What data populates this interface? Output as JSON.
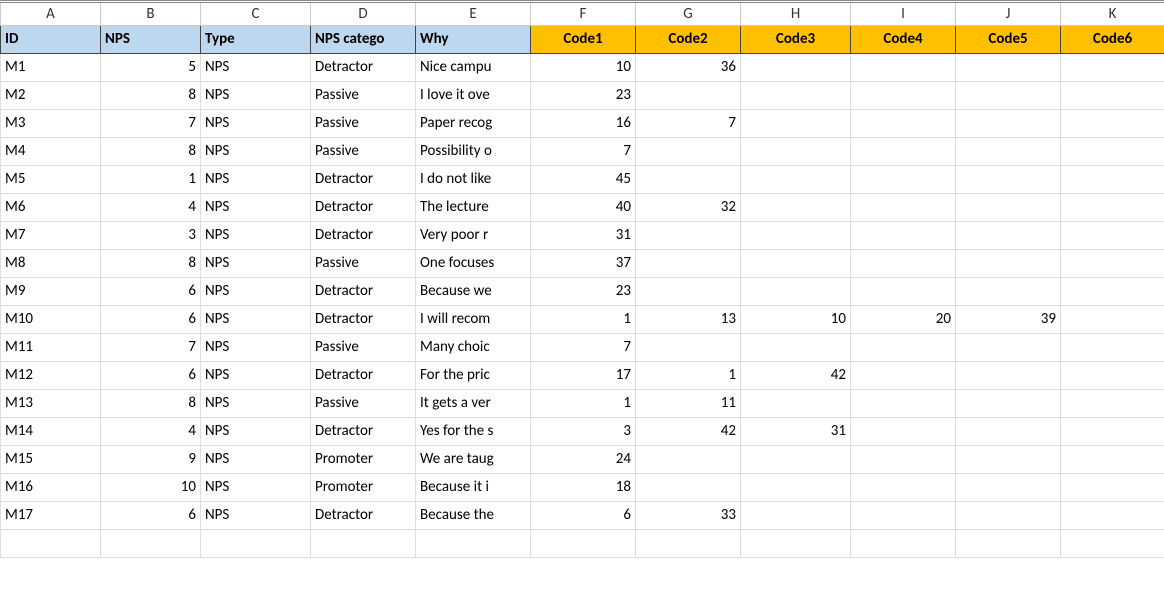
{
  "columns": [
    "A",
    "B",
    "C",
    "D",
    "E",
    "F",
    "G",
    "H",
    "I",
    "J",
    "K"
  ],
  "headers": {
    "blue": [
      "ID",
      "NPS",
      "Type",
      "NPS catego",
      "Why"
    ],
    "gold": [
      "Code1",
      "Code2",
      "Code3",
      "Code4",
      "Code5",
      "Code6"
    ]
  },
  "rows": [
    {
      "id": "M1",
      "nps": 5,
      "type": "NPS",
      "cat": "Detractor",
      "why": "Nice campu",
      "c": [
        10,
        36,
        "",
        "",
        "",
        ""
      ]
    },
    {
      "id": "M2",
      "nps": 8,
      "type": "NPS",
      "cat": "Passive",
      "why": "I love it ove",
      "c": [
        23,
        "",
        "",
        "",
        "",
        ""
      ]
    },
    {
      "id": "M3",
      "nps": 7,
      "type": "NPS",
      "cat": "Passive",
      "why": "Paper recog",
      "c": [
        16,
        7,
        "",
        "",
        "",
        ""
      ]
    },
    {
      "id": "M4",
      "nps": 8,
      "type": "NPS",
      "cat": "Passive",
      "why": "Possibility o",
      "c": [
        7,
        "",
        "",
        "",
        "",
        ""
      ]
    },
    {
      "id": "M5",
      "nps": 1,
      "type": "NPS",
      "cat": "Detractor",
      "why": "I do not like",
      "c": [
        45,
        "",
        "",
        "",
        "",
        ""
      ]
    },
    {
      "id": "M6",
      "nps": 4,
      "type": "NPS",
      "cat": "Detractor",
      "why": "The lecture",
      "c": [
        40,
        32,
        "",
        "",
        "",
        ""
      ]
    },
    {
      "id": "M7",
      "nps": 3,
      "type": "NPS",
      "cat": "Detractor",
      "why": "Very poor r",
      "c": [
        31,
        "",
        "",
        "",
        "",
        ""
      ]
    },
    {
      "id": "M8",
      "nps": 8,
      "type": "NPS",
      "cat": "Passive",
      "why": "One focuses",
      "c": [
        37,
        "",
        "",
        "",
        "",
        ""
      ]
    },
    {
      "id": "M9",
      "nps": 6,
      "type": "NPS",
      "cat": "Detractor",
      "why": "Because we",
      "c": [
        23,
        "",
        "",
        "",
        "",
        ""
      ]
    },
    {
      "id": "M10",
      "nps": 6,
      "type": "NPS",
      "cat": "Detractor",
      "why": "I will recom",
      "c": [
        1,
        13,
        10,
        20,
        39,
        ""
      ]
    },
    {
      "id": "M11",
      "nps": 7,
      "type": "NPS",
      "cat": "Passive",
      "why": "Many choic",
      "c": [
        7,
        "",
        "",
        "",
        "",
        ""
      ]
    },
    {
      "id": "M12",
      "nps": 6,
      "type": "NPS",
      "cat": "Detractor",
      "why": "For the pric",
      "c": [
        17,
        1,
        42,
        "",
        "",
        ""
      ]
    },
    {
      "id": "M13",
      "nps": 8,
      "type": "NPS",
      "cat": "Passive",
      "why": "It gets a ver",
      "c": [
        1,
        11,
        "",
        "",
        "",
        ""
      ]
    },
    {
      "id": "M14",
      "nps": 4,
      "type": "NPS",
      "cat": "Detractor",
      "why": "Yes for the s",
      "c": [
        3,
        42,
        31,
        "",
        "",
        ""
      ]
    },
    {
      "id": "M15",
      "nps": 9,
      "type": "NPS",
      "cat": "Promoter",
      "why": "We are taug",
      "c": [
        24,
        "",
        "",
        "",
        "",
        ""
      ]
    },
    {
      "id": "M16",
      "nps": 10,
      "type": "NPS",
      "cat": "Promoter",
      "why": "Because it i",
      "c": [
        18,
        "",
        "",
        "",
        "",
        ""
      ]
    },
    {
      "id": "M17",
      "nps": 6,
      "type": "NPS",
      "cat": "Detractor",
      "why": "Because the",
      "c": [
        6,
        33,
        "",
        "",
        "",
        ""
      ]
    }
  ]
}
